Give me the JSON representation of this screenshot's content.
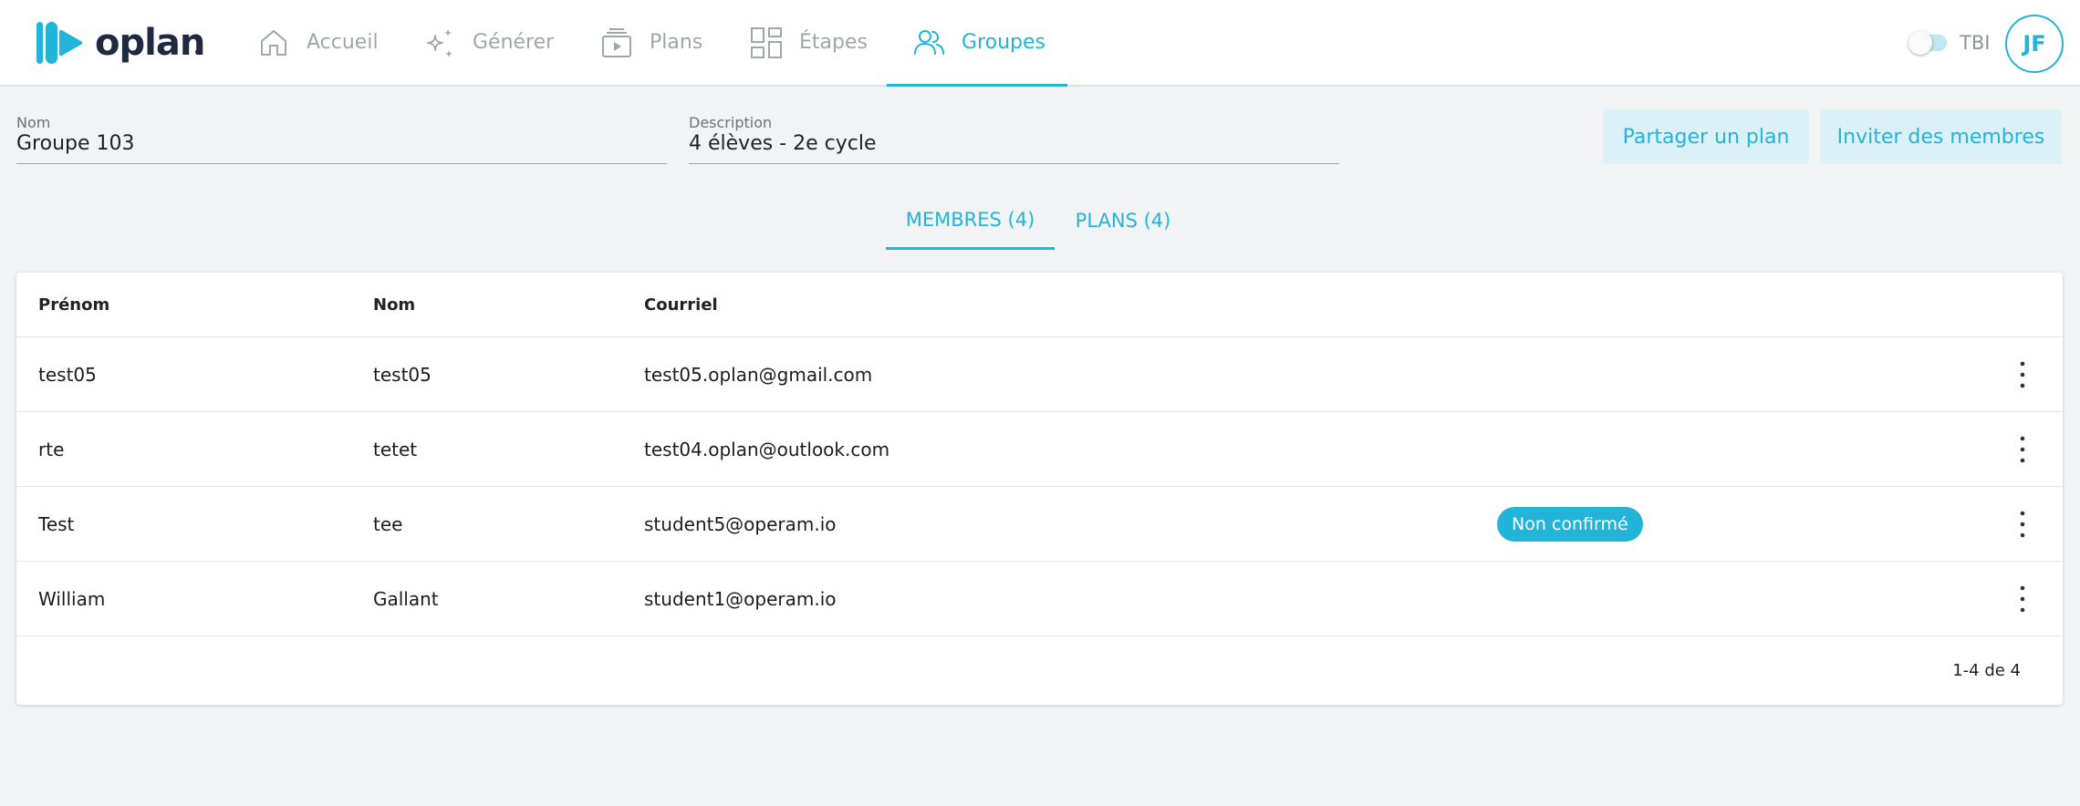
{
  "app": {
    "logo_text": "oplan",
    "brand_color": "#22b4d9",
    "logo_color": "#1f2940"
  },
  "nav": {
    "items": [
      {
        "label": "Accueil",
        "icon": "home-icon",
        "active": false
      },
      {
        "label": "Générer",
        "icon": "sparkle-icon",
        "active": false
      },
      {
        "label": "Plans",
        "icon": "play-plan-icon",
        "active": false
      },
      {
        "label": "Étapes",
        "icon": "grid-icon",
        "active": false
      },
      {
        "label": "Groupes",
        "icon": "group-icon",
        "active": true
      }
    ],
    "tbi_label": "TBI",
    "tbi_enabled": false,
    "avatar_initials": "JF"
  },
  "group": {
    "name_label": "Nom",
    "name_value": "Groupe 103",
    "description_label": "Description",
    "description_value": "4 élèves - 2e cycle"
  },
  "actions": {
    "share_plan": "Partager un plan",
    "invite_members": "Inviter des membres"
  },
  "tabs": [
    {
      "label": "MEMBRES (4)",
      "active": true
    },
    {
      "label": "PLANS (4)",
      "active": false
    }
  ],
  "table": {
    "columns": [
      "Prénom",
      "Nom",
      "Courriel"
    ],
    "rows": [
      {
        "first": "test05",
        "last": "test05",
        "email": "test05.oplan@gmail.com",
        "status": ""
      },
      {
        "first": "rte",
        "last": "tetet",
        "email": "test04.oplan@outlook.com",
        "status": ""
      },
      {
        "first": "Test",
        "last": "tee",
        "email": "student5@operam.io",
        "status": "Non confirmé"
      },
      {
        "first": "William",
        "last": "Gallant",
        "email": "student1@operam.io",
        "status": ""
      }
    ],
    "pagination": "1-4 de 4"
  }
}
